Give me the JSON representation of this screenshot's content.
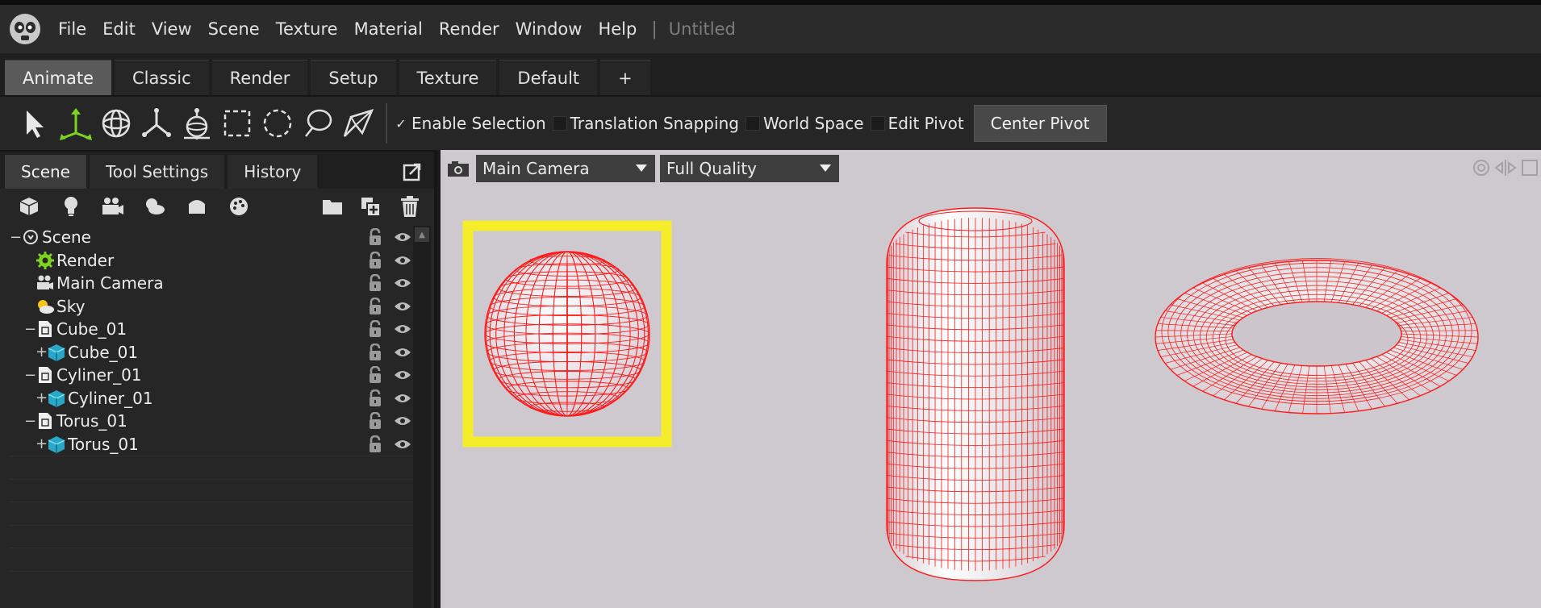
{
  "menubar": {
    "items": [
      "File",
      "Edit",
      "View",
      "Scene",
      "Texture",
      "Material",
      "Render",
      "Window",
      "Help"
    ],
    "separator": "|",
    "document_title": "Untitled"
  },
  "layout_tabs": [
    "Animate",
    "Classic",
    "Render",
    "Setup",
    "Texture",
    "Default",
    "+"
  ],
  "toolbar": {
    "tools": [
      "select-arrow-icon",
      "translate-gizmo-icon",
      "rotate-gizmo-icon",
      "scale-gizmo-icon",
      "pivot-tool-icon",
      "rect-select-icon",
      "circle-select-icon",
      "lasso-select-icon",
      "paint-select-icon"
    ],
    "options": [
      {
        "label": "Enable Selection",
        "checked": true
      },
      {
        "label": "Translation Snapping",
        "checked": false
      },
      {
        "label": "World Space",
        "checked": false
      },
      {
        "label": "Edit Pivot",
        "checked": false
      }
    ],
    "center_pivot_label": "Center Pivot"
  },
  "left_panel": {
    "tabs": [
      "Scene",
      "Tool Settings",
      "History"
    ],
    "icons": [
      "cube-icon",
      "light-bulb-icon",
      "camera-icon",
      "sky-icon",
      "material-icon",
      "palette-icon",
      "folder-icon",
      "add-item-icon",
      "trash-icon"
    ],
    "tree": [
      {
        "label": "Scene",
        "depth": 0,
        "expander": "−",
        "icon": "scene-icon"
      },
      {
        "label": "Render",
        "depth": 1,
        "expander": "",
        "icon": "render-gear-icon"
      },
      {
        "label": "Main Camera",
        "depth": 1,
        "expander": "",
        "icon": "camera-icon"
      },
      {
        "label": "Sky",
        "depth": 1,
        "expander": "",
        "icon": "sky-icon"
      },
      {
        "label": "Cube_01",
        "depth": 1,
        "expander": "−",
        "icon": "group-icon"
      },
      {
        "label": "Cube_01",
        "depth": 2,
        "expander": "+",
        "icon": "mesh-cube-icon"
      },
      {
        "label": "Cyliner_01",
        "depth": 1,
        "expander": "−",
        "icon": "group-icon"
      },
      {
        "label": "Cyliner_01",
        "depth": 2,
        "expander": "+",
        "icon": "mesh-cube-icon"
      },
      {
        "label": "Torus_01",
        "depth": 1,
        "expander": "−",
        "icon": "group-icon"
      },
      {
        "label": "Torus_01",
        "depth": 2,
        "expander": "+",
        "icon": "mesh-cube-icon"
      }
    ]
  },
  "viewport": {
    "camera": "Main Camera",
    "quality": "Full Quality",
    "background": "#cec8cf",
    "wire_color": "#ff1a1a",
    "selection_color": "#f5ec2a",
    "objects": [
      "sphere",
      "cylinder",
      "torus"
    ]
  }
}
